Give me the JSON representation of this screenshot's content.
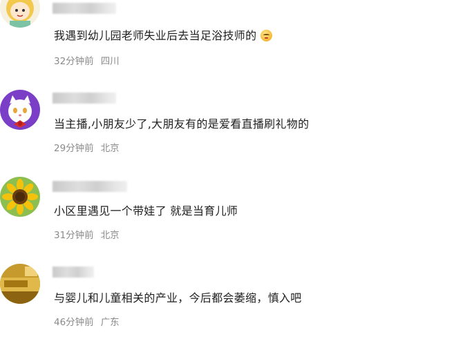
{
  "comments": [
    {
      "avatar_icon": "cartoon-girl-avatar-icon",
      "text": "我遇到幼儿园老师失业后去当足浴技师的",
      "emoji_icon": "smirk-emoji-icon",
      "time": "32分钟前",
      "location": "四川"
    },
    {
      "avatar_icon": "cartoon-cat-avatar-icon",
      "text": "当主播,小朋友少了,大朋友有的是爱看直播刷礼物的",
      "time": "29分钟前",
      "location": "北京"
    },
    {
      "avatar_icon": "sunflower-avatar-icon",
      "text": "小区里遇见一个带娃了 就是当育儿师",
      "time": "31分钟前",
      "location": "北京"
    },
    {
      "avatar_icon": "gold-photo-avatar-icon",
      "text": "与婴儿和儿童相关的产业，今后都会萎缩，慎入吧",
      "time": "46分钟前",
      "location": "广东"
    }
  ],
  "colors": {
    "text": "#1f1f1f",
    "meta": "#8a8a8a",
    "background": "#ffffff"
  }
}
